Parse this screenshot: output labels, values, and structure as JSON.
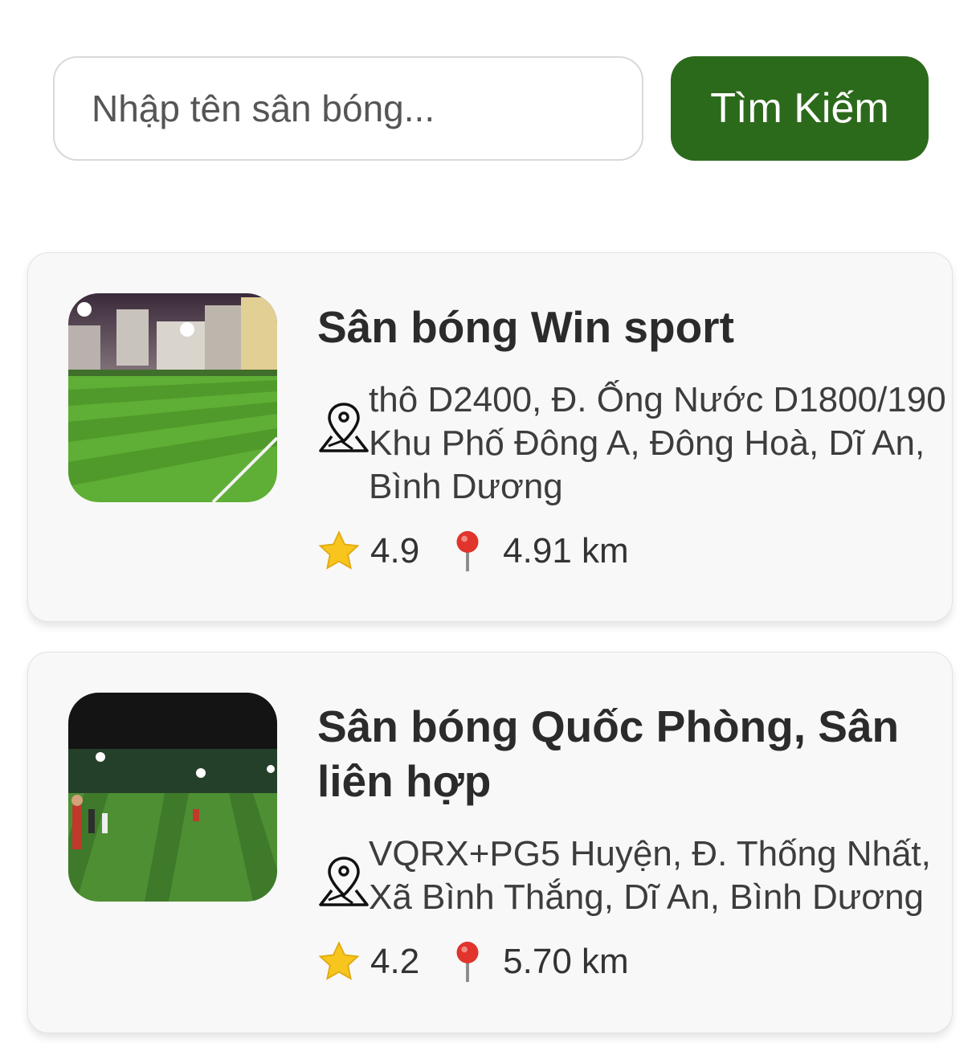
{
  "search": {
    "placeholder": "Nhập tên sân bóng...",
    "value": "",
    "button_label": "Tìm Kiếm"
  },
  "icons": {
    "address": "map-location-icon",
    "rating": "star-icon",
    "distance": "red-pin-icon"
  },
  "colors": {
    "button_bg": "#2c6a1b",
    "card_bg": "#f8f8f8",
    "star": "#f7c51e",
    "pin": "#e0342c"
  },
  "fields": [
    {
      "name": "Sân bóng Win sport",
      "address": "thô D2400, Đ. Ống Nước D1800/190\nKhu Phố Đông A, Đông Hoà, Dĩ An,\nBình Dương",
      "rating": "4.9",
      "distance": "4.91 km"
    },
    {
      "name": "Sân bóng Quốc Phòng, Sân liên hợp",
      "address": "VQRX+PG5 Huyện, Đ. Thống Nhất,\nXã Bình Thắng, Dĩ An, Bình Dương",
      "rating": "4.2",
      "distance": "5.70 km"
    }
  ]
}
